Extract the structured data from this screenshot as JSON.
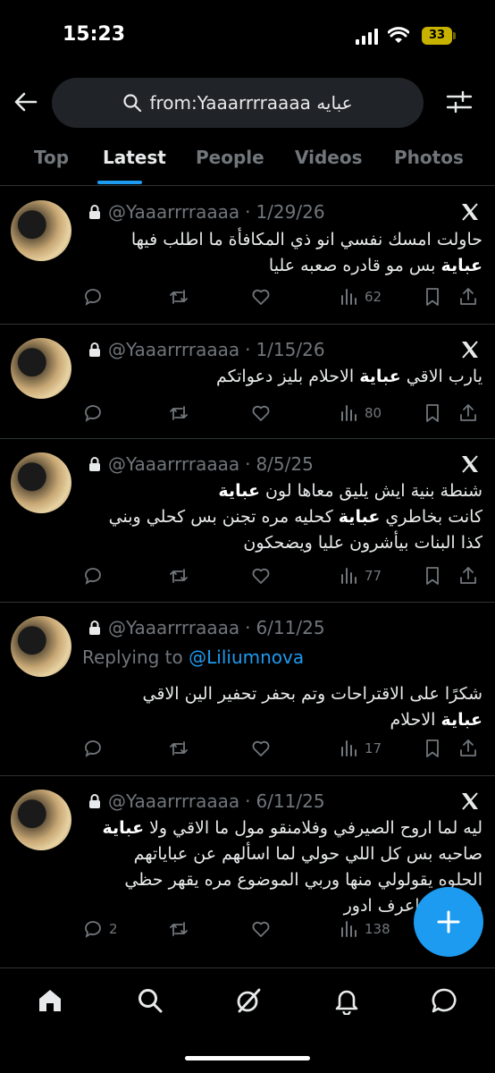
{
  "status_bar": {
    "time": "15:23",
    "battery": "33"
  },
  "search": {
    "query": "from:Yaaarrrraaaa عبايه"
  },
  "tabs": [
    {
      "label": "Top",
      "active": false
    },
    {
      "label": "Latest",
      "active": true
    },
    {
      "label": "People",
      "active": false
    },
    {
      "label": "Videos",
      "active": false
    },
    {
      "label": "Photos",
      "active": false
    }
  ],
  "tweets": [
    {
      "handle": "@Yaaarrrraaaa",
      "date": "1/29/26",
      "lines": [
        [
          "حاولت امسك نفسي انو ذي المكافأة ما اطلب فيها"
        ],
        [
          {
            "b": "عباية"
          },
          " بس مو قادره صعبه عليا"
        ]
      ],
      "views": "62"
    },
    {
      "handle": "@Yaaarrrraaaa",
      "date": "1/15/26",
      "lines": [
        [
          "يارب الاقي ",
          {
            "b": "عباية"
          },
          " الاحلام بليز دعواتكم"
        ]
      ],
      "views": "80"
    },
    {
      "handle": "@Yaaarrrraaaa",
      "date": "8/5/25",
      "lines": [
        [
          "شنطة بنية ايش يليق معاها لون ",
          {
            "b": "عباية"
          }
        ],
        [
          "كانت بخاطري ",
          {
            "b": "عباية"
          },
          " كحليه مره تجنن بس كحلي وبني"
        ],
        [
          "كذا البنات بيأشرون عليا ويضحكون"
        ]
      ],
      "views": "77"
    },
    {
      "handle": "@Yaaarrrraaaa",
      "date": "6/11/25",
      "replying_to_label": "Replying to",
      "replying_to": "@Liliumnova",
      "lines": [
        [
          "شكرًا على الاقتراحات وتم بحفر تحفير الين الاقي"
        ],
        [
          {
            "b": "عباية"
          },
          " الاحلام"
        ]
      ],
      "views": "17"
    },
    {
      "handle": "@Yaaarrrraaaa",
      "date": "6/11/25",
      "lines": [
        [
          "ليه لما اروح الصيرفي وفلامنقو مول ما الاقي ولا ",
          {
            "b": "عباية"
          }
        ],
        [
          "صاحبه بس كل اللي حولي لما اسألهم عن عباياتهم"
        ],
        [
          "الحلوه يقولولي منها وربي الموضوع مره يقهر حظي"
        ],
        [
          "ولا انا ما اعرف ادور"
        ]
      ],
      "replies": "2",
      "views": "138"
    }
  ],
  "icons": {
    "back": "arrow-left-icon",
    "search": "search-icon",
    "filter": "sliders-icon",
    "lock": "lock-icon",
    "brand": "x-logo-icon",
    "reply": "reply-icon",
    "retweet": "retweet-icon",
    "like": "heart-icon",
    "views": "views-icon",
    "bookmark": "bookmark-icon",
    "share": "share-icon",
    "compose": "plus-icon",
    "nav": [
      "home-icon",
      "search-icon",
      "grok-icon",
      "notifications-icon",
      "messages-icon"
    ]
  },
  "colors": {
    "accent": "#1d9bf0",
    "text": "#e7e9ea",
    "muted": "#71767b",
    "battery": "#c8b200"
  }
}
